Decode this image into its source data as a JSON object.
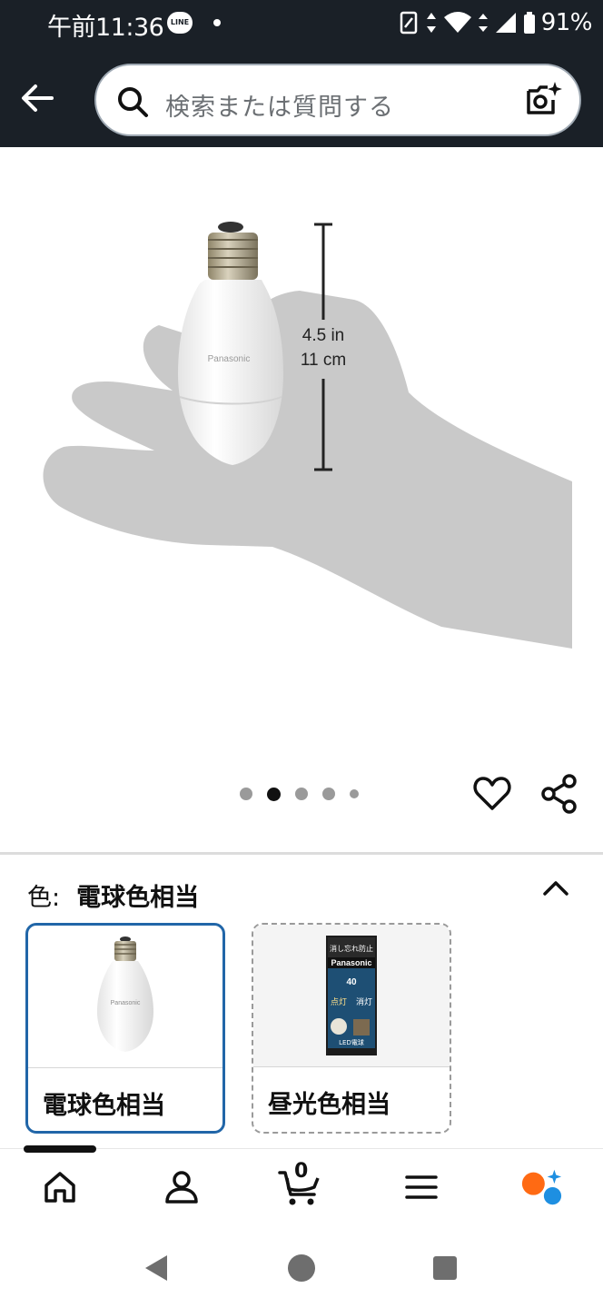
{
  "status_bar": {
    "time": "午前11:36",
    "line_badge": "LINE",
    "battery": "91%"
  },
  "search": {
    "placeholder": "検索または質問する"
  },
  "product_image": {
    "brand_on_bulb": "Panasonic",
    "dimension_in": "4.5 in",
    "dimension_cm": "11 cm",
    "carousel_total": 5,
    "carousel_active_index": 2
  },
  "variation": {
    "key_label": "色:",
    "selected_value": "電球色相当",
    "options": [
      {
        "label": "電球色相当",
        "selected": true
      },
      {
        "label": "昼光色相当",
        "selected": false
      }
    ]
  },
  "package_text": {
    "brand": "Panasonic",
    "line1": "消し忘れ防止",
    "watt": "40",
    "left_word": "点灯",
    "right_word": "消灯",
    "led": "LED電球"
  },
  "bottom_nav": {
    "cart_count": "0"
  },
  "colors": {
    "header_bg": "#1a2027",
    "selected_border": "#2166a8",
    "rufus_orange": "#ff6a13",
    "rufus_blue": "#1e8fe1"
  },
  "icons": [
    "back-arrow-icon",
    "search-icon",
    "camera-sparkle-icon",
    "heart-icon",
    "share-icon",
    "chevron-up-icon",
    "home-icon",
    "account-icon",
    "cart-icon",
    "menu-icon",
    "rufus-icon"
  ]
}
